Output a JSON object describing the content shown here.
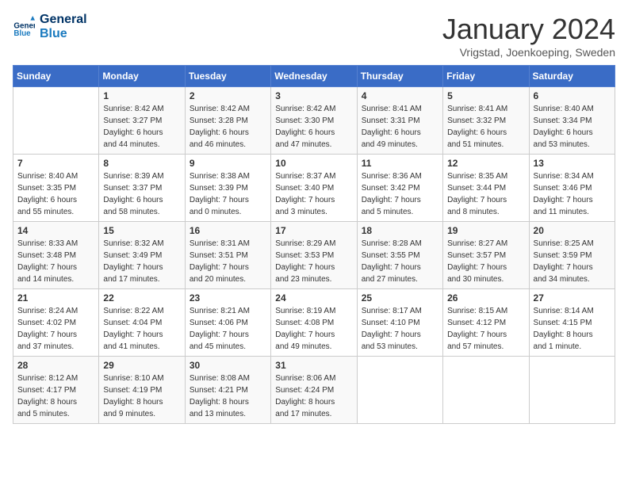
{
  "logo": {
    "line1": "General",
    "line2": "Blue"
  },
  "title": "January 2024",
  "location": "Vrigstad, Joenkoeping, Sweden",
  "days_header": [
    "Sunday",
    "Monday",
    "Tuesday",
    "Wednesday",
    "Thursday",
    "Friday",
    "Saturday"
  ],
  "weeks": [
    [
      {
        "day": "",
        "info": ""
      },
      {
        "day": "1",
        "info": "Sunrise: 8:42 AM\nSunset: 3:27 PM\nDaylight: 6 hours\nand 44 minutes."
      },
      {
        "day": "2",
        "info": "Sunrise: 8:42 AM\nSunset: 3:28 PM\nDaylight: 6 hours\nand 46 minutes."
      },
      {
        "day": "3",
        "info": "Sunrise: 8:42 AM\nSunset: 3:30 PM\nDaylight: 6 hours\nand 47 minutes."
      },
      {
        "day": "4",
        "info": "Sunrise: 8:41 AM\nSunset: 3:31 PM\nDaylight: 6 hours\nand 49 minutes."
      },
      {
        "day": "5",
        "info": "Sunrise: 8:41 AM\nSunset: 3:32 PM\nDaylight: 6 hours\nand 51 minutes."
      },
      {
        "day": "6",
        "info": "Sunrise: 8:40 AM\nSunset: 3:34 PM\nDaylight: 6 hours\nand 53 minutes."
      }
    ],
    [
      {
        "day": "7",
        "info": "Sunrise: 8:40 AM\nSunset: 3:35 PM\nDaylight: 6 hours\nand 55 minutes."
      },
      {
        "day": "8",
        "info": "Sunrise: 8:39 AM\nSunset: 3:37 PM\nDaylight: 6 hours\nand 58 minutes."
      },
      {
        "day": "9",
        "info": "Sunrise: 8:38 AM\nSunset: 3:39 PM\nDaylight: 7 hours\nand 0 minutes."
      },
      {
        "day": "10",
        "info": "Sunrise: 8:37 AM\nSunset: 3:40 PM\nDaylight: 7 hours\nand 3 minutes."
      },
      {
        "day": "11",
        "info": "Sunrise: 8:36 AM\nSunset: 3:42 PM\nDaylight: 7 hours\nand 5 minutes."
      },
      {
        "day": "12",
        "info": "Sunrise: 8:35 AM\nSunset: 3:44 PM\nDaylight: 7 hours\nand 8 minutes."
      },
      {
        "day": "13",
        "info": "Sunrise: 8:34 AM\nSunset: 3:46 PM\nDaylight: 7 hours\nand 11 minutes."
      }
    ],
    [
      {
        "day": "14",
        "info": "Sunrise: 8:33 AM\nSunset: 3:48 PM\nDaylight: 7 hours\nand 14 minutes."
      },
      {
        "day": "15",
        "info": "Sunrise: 8:32 AM\nSunset: 3:49 PM\nDaylight: 7 hours\nand 17 minutes."
      },
      {
        "day": "16",
        "info": "Sunrise: 8:31 AM\nSunset: 3:51 PM\nDaylight: 7 hours\nand 20 minutes."
      },
      {
        "day": "17",
        "info": "Sunrise: 8:29 AM\nSunset: 3:53 PM\nDaylight: 7 hours\nand 23 minutes."
      },
      {
        "day": "18",
        "info": "Sunrise: 8:28 AM\nSunset: 3:55 PM\nDaylight: 7 hours\nand 27 minutes."
      },
      {
        "day": "19",
        "info": "Sunrise: 8:27 AM\nSunset: 3:57 PM\nDaylight: 7 hours\nand 30 minutes."
      },
      {
        "day": "20",
        "info": "Sunrise: 8:25 AM\nSunset: 3:59 PM\nDaylight: 7 hours\nand 34 minutes."
      }
    ],
    [
      {
        "day": "21",
        "info": "Sunrise: 8:24 AM\nSunset: 4:02 PM\nDaylight: 7 hours\nand 37 minutes."
      },
      {
        "day": "22",
        "info": "Sunrise: 8:22 AM\nSunset: 4:04 PM\nDaylight: 7 hours\nand 41 minutes."
      },
      {
        "day": "23",
        "info": "Sunrise: 8:21 AM\nSunset: 4:06 PM\nDaylight: 7 hours\nand 45 minutes."
      },
      {
        "day": "24",
        "info": "Sunrise: 8:19 AM\nSunset: 4:08 PM\nDaylight: 7 hours\nand 49 minutes."
      },
      {
        "day": "25",
        "info": "Sunrise: 8:17 AM\nSunset: 4:10 PM\nDaylight: 7 hours\nand 53 minutes."
      },
      {
        "day": "26",
        "info": "Sunrise: 8:15 AM\nSunset: 4:12 PM\nDaylight: 7 hours\nand 57 minutes."
      },
      {
        "day": "27",
        "info": "Sunrise: 8:14 AM\nSunset: 4:15 PM\nDaylight: 8 hours\nand 1 minute."
      }
    ],
    [
      {
        "day": "28",
        "info": "Sunrise: 8:12 AM\nSunset: 4:17 PM\nDaylight: 8 hours\nand 5 minutes."
      },
      {
        "day": "29",
        "info": "Sunrise: 8:10 AM\nSunset: 4:19 PM\nDaylight: 8 hours\nand 9 minutes."
      },
      {
        "day": "30",
        "info": "Sunrise: 8:08 AM\nSunset: 4:21 PM\nDaylight: 8 hours\nand 13 minutes."
      },
      {
        "day": "31",
        "info": "Sunrise: 8:06 AM\nSunset: 4:24 PM\nDaylight: 8 hours\nand 17 minutes."
      },
      {
        "day": "",
        "info": ""
      },
      {
        "day": "",
        "info": ""
      },
      {
        "day": "",
        "info": ""
      }
    ]
  ]
}
